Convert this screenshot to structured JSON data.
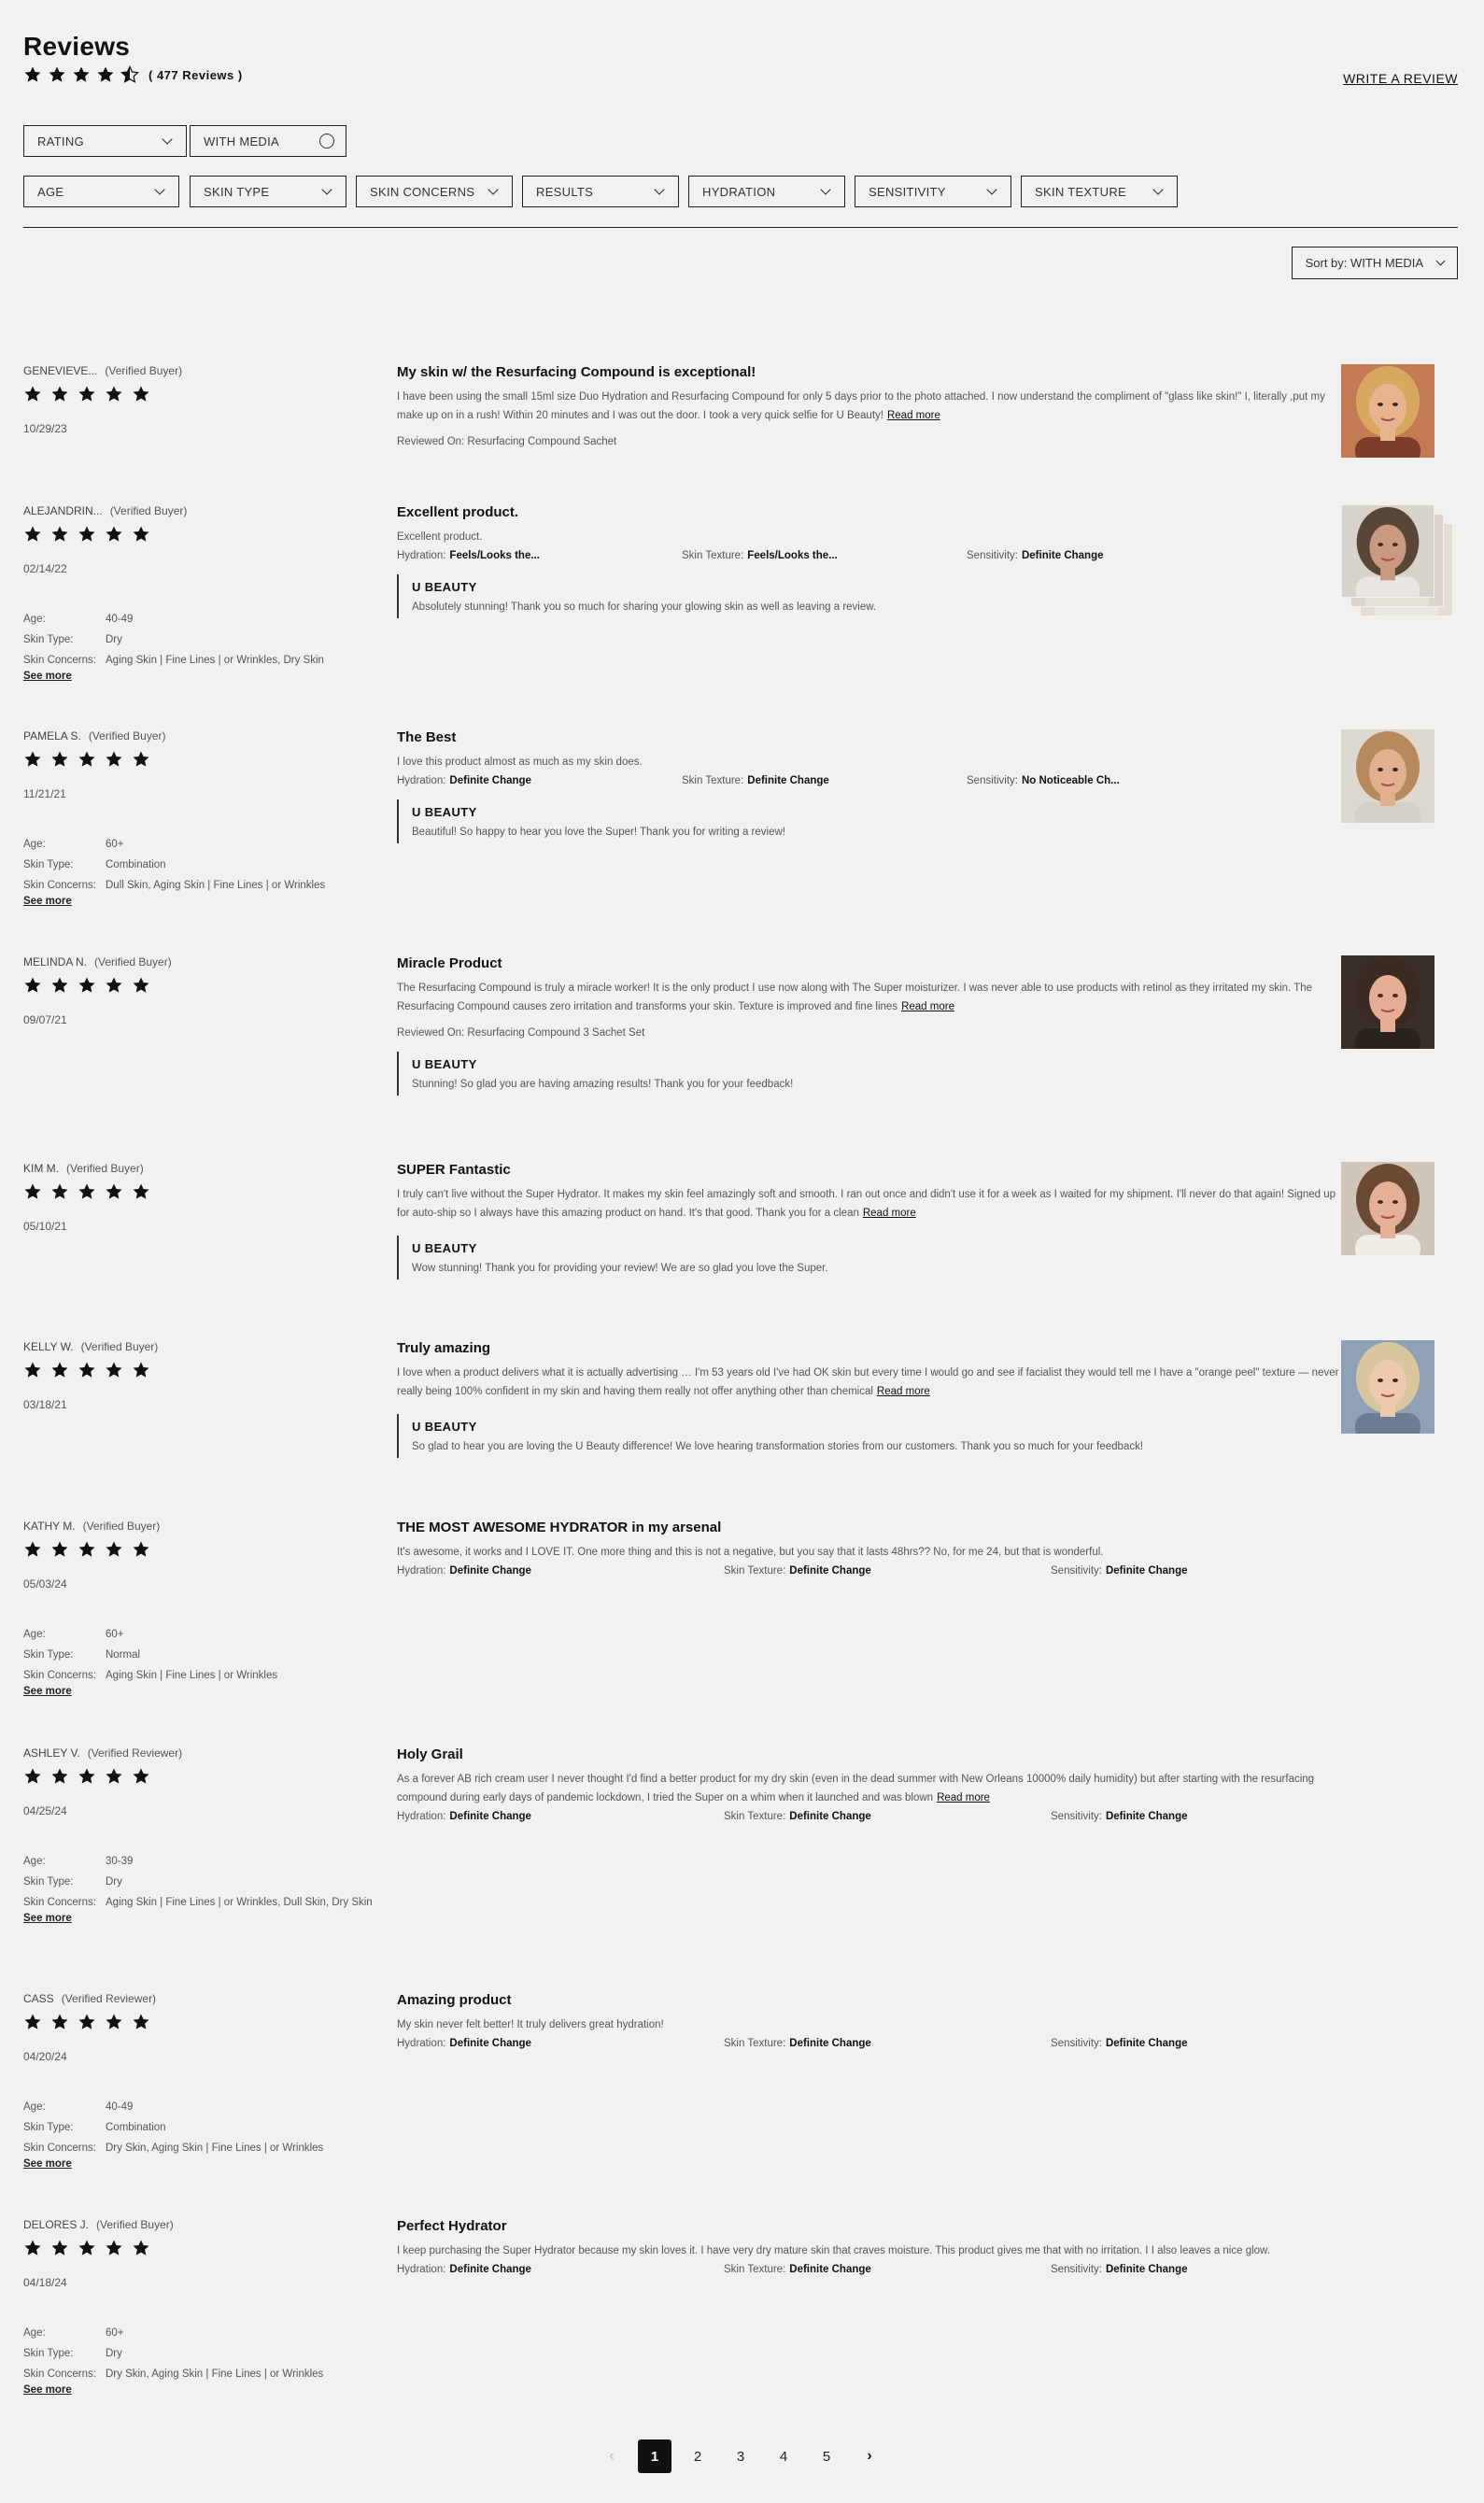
{
  "header": {
    "title": "Reviews",
    "rating": 4.5,
    "review_count": "( 477 Reviews )",
    "write_review": "WRITE A REVIEW"
  },
  "filters": {
    "row1": [
      "RATING",
      "WITH MEDIA"
    ],
    "row2": [
      "AGE",
      "SKIN TYPE",
      "SKIN CONCERNS",
      "RESULTS",
      "HYDRATION",
      "SENSITIVITY",
      "SKIN TEXTURE"
    ]
  },
  "sort": {
    "label": "Sort by: WITH MEDIA"
  },
  "reviews": [
    {
      "name": "GENEVIEVE...",
      "badge": "(Verified Buyer)",
      "date": "10/29/23",
      "stars": 5,
      "title": "My skin w/ the Resurfacing Compound is exceptional!",
      "text": "I have been using the small 15ml size Duo Hydration and Resurfacing Compound for only 5 days prior to the photo attached. I now understand the compliment of \"glass like skin!\" I, literally ,put my make up on in a rush! Within 20 minutes and I was out the door. I took a very quick selfie for U Beauty!",
      "read_more": "Read more",
      "reviewed_on": "Reviewed On: Resurfacing Compound Sachet"
    },
    {
      "name": "ALEJANDRIN...",
      "badge": "(Verified Buyer)",
      "date": "02/14/22",
      "stars": 5,
      "attrs": [
        [
          "Age:",
          "40-49"
        ],
        [
          "Skin Type:",
          "Dry"
        ],
        [
          "Skin Concerns:",
          "Aging Skin | Fine Lines | or Wrinkles, Dry Skin"
        ]
      ],
      "see_more": "See more",
      "title": "Excellent product.",
      "text": "Excellent product.",
      "metrics": [
        [
          "Hydration:",
          "Feels/Looks the..."
        ],
        [
          "Skin Texture:",
          "Feels/Looks the..."
        ],
        [
          "Sensitivity:",
          "Definite Change"
        ]
      ],
      "brand": "U BEAUTY",
      "brand_text": "Absolutely stunning! Thank you so much for sharing your glowing skin as well as leaving a review."
    },
    {
      "name": "PAMELA S.",
      "badge": "(Verified Buyer)",
      "date": "11/21/21",
      "stars": 5,
      "attrs": [
        [
          "Age:",
          "60+"
        ],
        [
          "Skin Type:",
          "Combination"
        ],
        [
          "Skin Concerns:",
          "Dull Skin, Aging Skin | Fine Lines | or Wrinkles"
        ]
      ],
      "see_more": "See more",
      "title": "The Best",
      "text": "I love this product almost as much as my skin does.",
      "metrics": [
        [
          "Hydration:",
          "Definite Change"
        ],
        [
          "Skin Texture:",
          "Definite Change"
        ],
        [
          "Sensitivity:",
          "No Noticeable Ch..."
        ]
      ],
      "brand": "U BEAUTY",
      "brand_text": "Beautiful! So happy to hear you love the Super! Thank you for writing a review!"
    },
    {
      "name": "MELINDA N.",
      "badge": "(Verified Buyer)",
      "date": "09/07/21",
      "stars": 5,
      "title": "Miracle Product",
      "text": "The Resurfacing Compound is truly a miracle worker! It is the only product I use now along with The Super moisturizer. I was never able to use products with retinol as they irritated my skin. The Resurfacing Compound causes zero irritation and transforms your skin. Texture is improved and fine lines",
      "read_more": "Read more",
      "reviewed_on": "Reviewed On: Resurfacing Compound 3 Sachet Set",
      "brand": "U BEAUTY",
      "brand_text": "Stunning! So glad you are having amazing results! Thank you for your feedback!"
    },
    {
      "name": "KIM M.",
      "badge": "(Verified Buyer)",
      "date": "05/10/21",
      "stars": 5,
      "title": "SUPER Fantastic",
      "text": "I truly can't live without the Super Hydrator. It makes my skin feel amazingly soft and smooth. I ran out once and didn't use it for a week as I waited for my shipment. I'll never do that again! Signed up for auto-ship so I always have this amazing product on hand. It's that good. Thank you for a clean",
      "read_more": "Read more",
      "brand": "U BEAUTY",
      "brand_text": "Wow stunning! Thank you for providing your review! We are so glad you love the Super."
    },
    {
      "name": "KELLY W.",
      "badge": "(Verified Buyer)",
      "date": "03/18/21",
      "stars": 5,
      "title": "Truly amazing",
      "text": "I love when a product delivers what it is actually advertising … I'm 53 years old I've had OK skin but every time I would go and see if facialist they would tell me I have a \"orange peel\" texture — never really being 100% confident in my skin and having them really not offer anything other than chemical",
      "read_more": "Read more",
      "brand": "U BEAUTY",
      "brand_text": "So glad to hear you are loving the U Beauty difference! We love hearing transformation stories from our customers. Thank you so much for your feedback!"
    },
    {
      "name": "KATHY M.",
      "badge": "(Verified Buyer)",
      "date": "05/03/24",
      "stars": 5,
      "attrs": [
        [
          "Age:",
          "60+"
        ],
        [
          "Skin Type:",
          "Normal"
        ],
        [
          "Skin Concerns:",
          "Aging Skin | Fine Lines | or Wrinkles"
        ]
      ],
      "see_more": "See more",
      "title": "THE MOST AWESOME HYDRATOR in my arsenal",
      "text": "It's awesome, it works and I LOVE IT. One more thing and this is not a negative, but you say that it lasts 48hrs?? No, for me 24, but that is wonderful.",
      "metrics": [
        [
          "Hydration:",
          "Definite Change"
        ],
        [
          "Skin Texture:",
          "Definite Change"
        ],
        [
          "Sensitivity:",
          "Definite Change"
        ]
      ]
    },
    {
      "name": "ASHLEY V.",
      "badge": "(Verified Reviewer)",
      "date": "04/25/24",
      "stars": 5,
      "attrs": [
        [
          "Age:",
          "30-39"
        ],
        [
          "Skin Type:",
          "Dry"
        ],
        [
          "Skin Concerns:",
          "Aging Skin | Fine Lines | or Wrinkles, Dull Skin, Dry Skin"
        ]
      ],
      "see_more": "See more",
      "title": "Holy Grail",
      "text": "As a forever AB rich cream user I never thought I'd find a better product for my dry skin (even in the dead summer with New Orleans 10000% daily humidity) but after starting with the resurfacing compound during early days of pandemic lockdown, I tried the Super on a whim when it launched and was blown",
      "read_more": "Read more",
      "metrics": [
        [
          "Hydration:",
          "Definite Change"
        ],
        [
          "Skin Texture:",
          "Definite Change"
        ],
        [
          "Sensitivity:",
          "Definite Change"
        ]
      ]
    },
    {
      "name": "CASS",
      "badge": "(Verified Reviewer)",
      "date": "04/20/24",
      "stars": 5,
      "attrs": [
        [
          "Age:",
          "40-49"
        ],
        [
          "Skin Type:",
          "Combination"
        ],
        [
          "Skin Concerns:",
          "Dry Skin, Aging Skin | Fine Lines | or Wrinkles"
        ]
      ],
      "see_more": "See more",
      "title": "Amazing product",
      "text": "My skin never felt better! It truly delivers great hydration!",
      "metrics": [
        [
          "Hydration:",
          "Definite Change"
        ],
        [
          "Skin Texture:",
          "Definite Change"
        ],
        [
          "Sensitivity:",
          "Definite Change"
        ]
      ]
    },
    {
      "name": "DELORES J.",
      "badge": "(Verified Buyer)",
      "date": "04/18/24",
      "stars": 5,
      "attrs": [
        [
          "Age:",
          "60+"
        ],
        [
          "Skin Type:",
          "Dry"
        ],
        [
          "Skin Concerns:",
          "Dry Skin, Aging Skin | Fine Lines | or Wrinkles"
        ]
      ],
      "see_more": "See more",
      "title": "Perfect Hydrator",
      "text": "I keep purchasing the Super Hydrator because my skin loves it. I have very dry mature skin that craves moisture. This product gives me that with no irritation. I I also leaves a nice glow.",
      "metrics": [
        [
          "Hydration:",
          "Definite Change"
        ],
        [
          "Skin Texture:",
          "Definite Change"
        ],
        [
          "Sensitivity:",
          "Definite Change"
        ]
      ]
    }
  ],
  "pagination": {
    "prev": "‹",
    "pages": [
      "1",
      "2",
      "3",
      "4",
      "5"
    ],
    "next": "›",
    "current": "1"
  }
}
